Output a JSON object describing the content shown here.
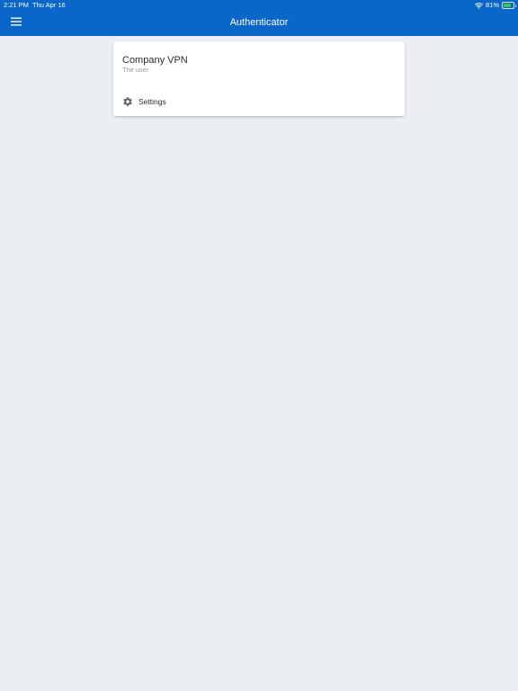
{
  "status_bar": {
    "time": "2:21 PM",
    "date": "Thu Apr 16",
    "battery_text": "81%",
    "battery_level": 0.81,
    "wifi_icon": "wifi-icon",
    "battery_icon": "battery-charging-icon"
  },
  "header": {
    "title": "Authenticator",
    "menu_icon": "hamburger-menu-icon",
    "background_color": "#0a66c9"
  },
  "account_card": {
    "name": "Company VPN",
    "user": "The user",
    "settings_icon": "gear-icon",
    "settings_label": "Settings"
  },
  "colors": {
    "page_background": "#ebeef2",
    "card_background": "#ffffff",
    "battery_fill": "#35c759"
  }
}
